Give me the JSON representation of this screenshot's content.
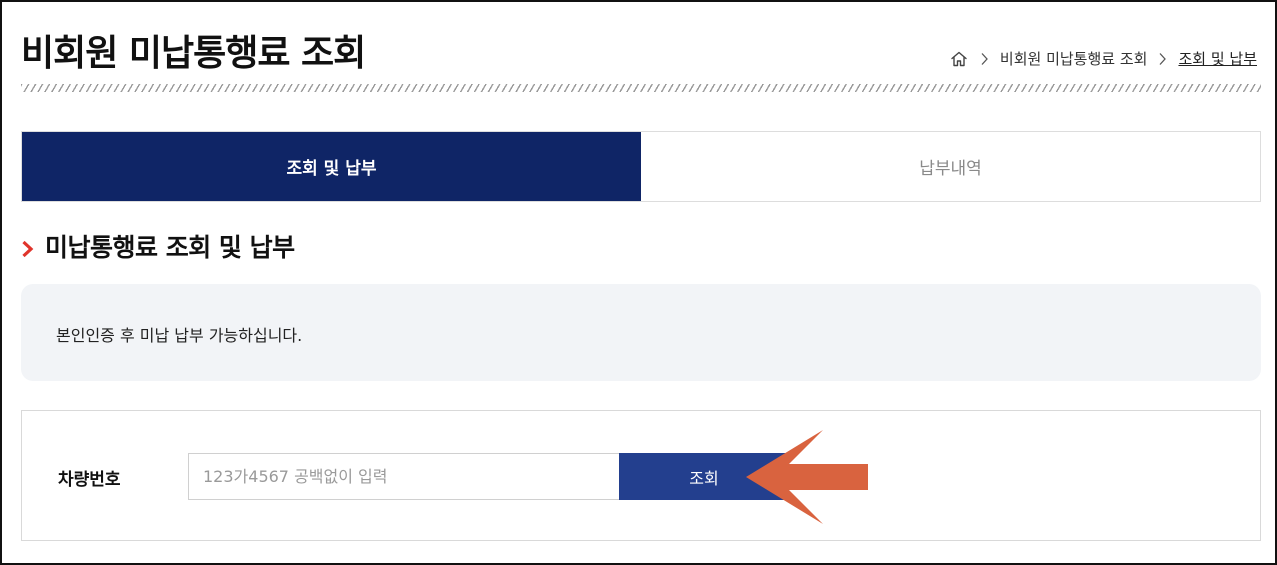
{
  "header": {
    "title": "비회원 미납통행료 조회"
  },
  "breadcrumb": {
    "home_icon": "home-icon",
    "items": [
      "비회원 미납통행료 조회",
      "조회 및 납부"
    ]
  },
  "tabs": [
    {
      "label": "조회 및 납부",
      "active": true
    },
    {
      "label": "납부내역",
      "active": false
    }
  ],
  "section": {
    "title": "미납통행료 조회 및 납부"
  },
  "notice": {
    "text": "본인인증 후 미납 납부 가능하십니다."
  },
  "search": {
    "label": "차량번호",
    "placeholder": "123가4567 공백없이 입력",
    "value": "",
    "button_label": "조회"
  },
  "colors": {
    "navy": "#0f2566",
    "button": "#233f8e",
    "accent_red": "#e0342b",
    "arrow": "#d9633f",
    "notice_bg": "#f2f4f7"
  }
}
